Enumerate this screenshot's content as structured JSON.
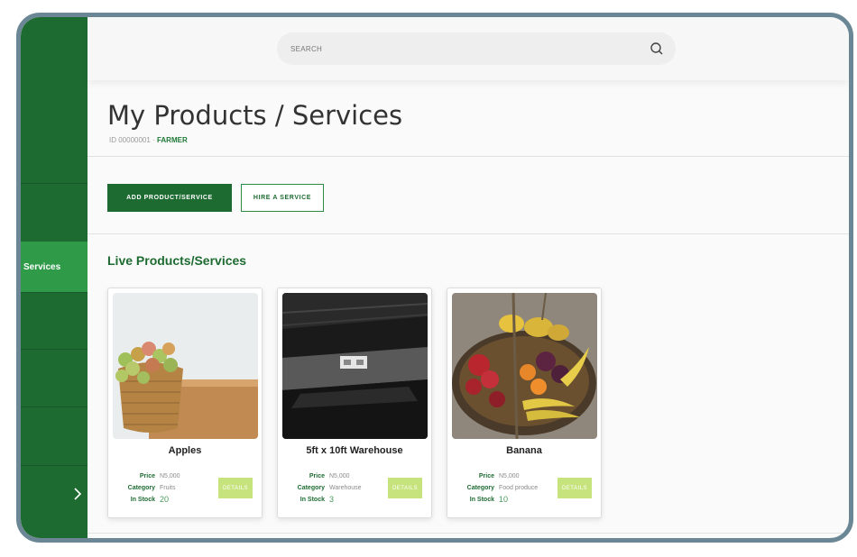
{
  "search": {
    "placeholder": "SEARCH"
  },
  "sidebar": {
    "active_item_label": "Services"
  },
  "header": {
    "title": "My Products / Services",
    "id_prefix": "ID 00000001 · ",
    "role": "FARMER"
  },
  "actions": {
    "add_label": "ADD PRODUCT/SERVICE",
    "hire_label": "HIRE A SERVICE"
  },
  "section": {
    "title": "Live Products/Services"
  },
  "labels": {
    "price": "Price",
    "category": "Category",
    "in_stock": "In Stock",
    "details": "DETAILS"
  },
  "products": [
    {
      "name": "Apples",
      "price": "N5,000",
      "category": "Fruits",
      "in_stock": "20"
    },
    {
      "name": "5ft x 10ft Warehouse",
      "price": "N5,000",
      "category": "Warehouse",
      "in_stock": "3"
    },
    {
      "name": "Banana",
      "price": "N5,000",
      "category": "Food produce",
      "in_stock": "10"
    }
  ],
  "colors": {
    "brand_green": "#1e6b32",
    "active_green": "#2f9a48",
    "details_lime": "#c6e37d"
  }
}
